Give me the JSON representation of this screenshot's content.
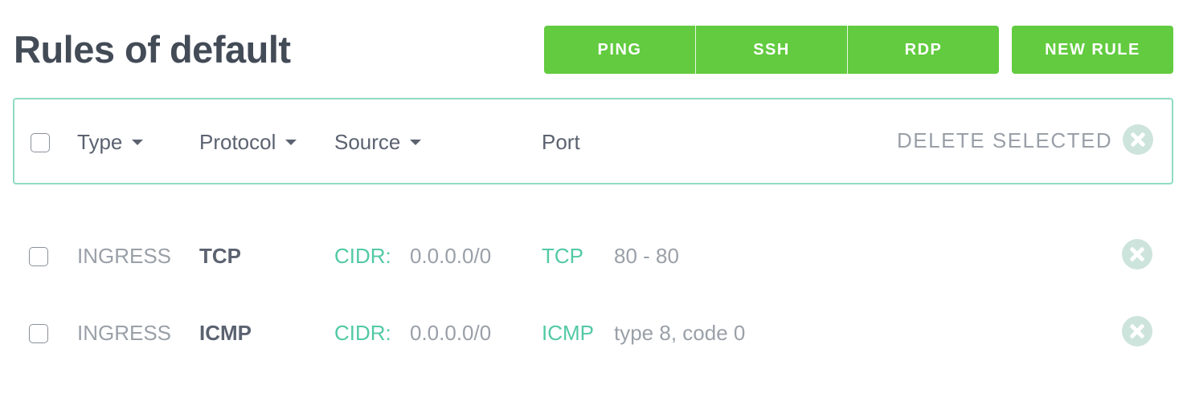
{
  "page": {
    "title": "Rules of default"
  },
  "toolbar": {
    "presets": [
      "PING",
      "SSH",
      "RDP"
    ],
    "new_rule": "NEW RULE"
  },
  "table": {
    "columns": {
      "type": "Type",
      "protocol": "Protocol",
      "source": "Source",
      "port": "Port"
    },
    "delete_selected": "DELETE SELECTED",
    "rows": [
      {
        "type": "INGRESS",
        "protocol": "TCP",
        "source_label": "CIDR:",
        "source_value": "0.0.0.0/0",
        "port_label": "TCP",
        "port_value": "80 - 80"
      },
      {
        "type": "INGRESS",
        "protocol": "ICMP",
        "source_label": "CIDR:",
        "source_value": "0.0.0.0/0",
        "port_label": "ICMP",
        "port_value": "type 8, code 0"
      }
    ]
  },
  "colors": {
    "accent_green": "#62cb3f",
    "teal": "#52c9a4",
    "border": "#8fdcc0",
    "delete_icon": "#cde4dd"
  },
  "icons": {
    "delete": "close-circle-icon",
    "sort": "caret-down-icon"
  }
}
